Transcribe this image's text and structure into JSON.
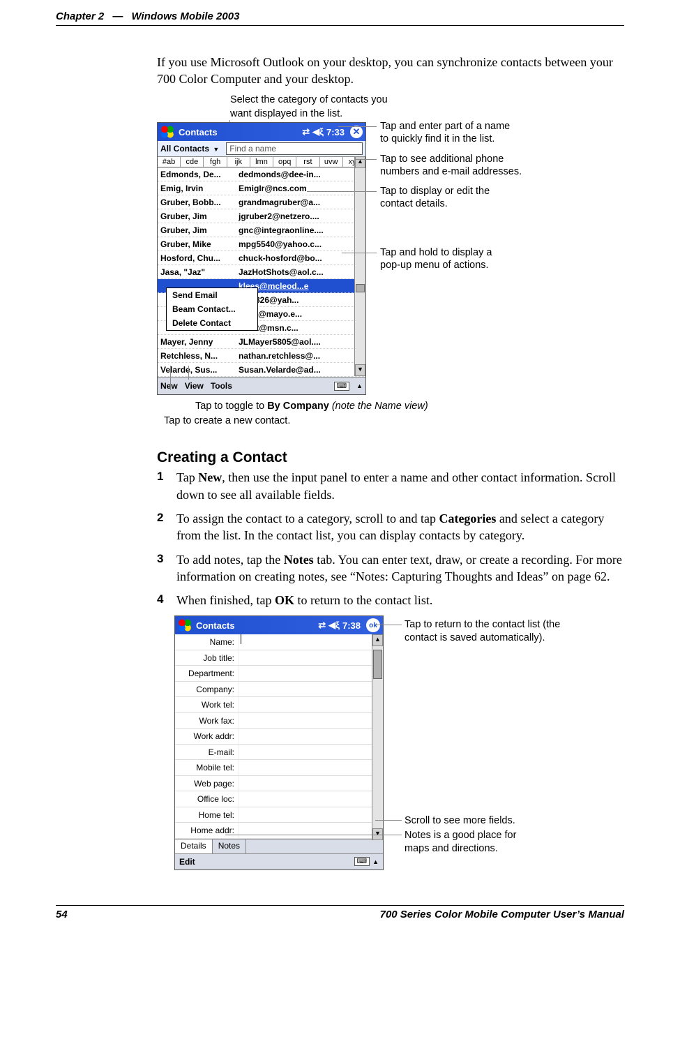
{
  "header": {
    "chapter": "Chapter 2",
    "dash": "—",
    "title": "Windows Mobile 2003"
  },
  "intro": "If you use Microsoft Outlook on your desktop, you can synchronize contacts between your 700 Color Computer and your desktop.",
  "callouts_top1": "Select the category of contacts you",
  "callouts_top2": "want displayed in the list.",
  "screenshot1": {
    "title": "Contacts",
    "time": "7:33",
    "category": "All Contacts",
    "find_placeholder": "Find a name",
    "alpha": [
      "#ab",
      "cde",
      "fgh",
      "ijk",
      "lmn",
      "opq",
      "rst",
      "uvw",
      "xyz"
    ],
    "rows": [
      {
        "n": "Edmonds, De...",
        "v": "dedmonds@dee-in...",
        "t": "e"
      },
      {
        "n": "Emig, Irvin",
        "v": "EmigIr@ncs.com",
        "t": "e"
      },
      {
        "n": "Gruber, Bobb...",
        "v": "grandmagruber@a...",
        "t": "e"
      },
      {
        "n": "Gruber, Jim",
        "v": "jgruber2@netzero....",
        "t": "e"
      },
      {
        "n": "Gruber, Jim",
        "v": "gnc@integraonline....",
        "t": "e"
      },
      {
        "n": "Gruber, Mike",
        "v": "mpg5540@yahoo.c...",
        "t": "e"
      },
      {
        "n": "Hosford, Chu...",
        "v": "chuck-hosford@bo...",
        "t": "e"
      },
      {
        "n": "Jasa, \"Jaz\"",
        "v": "JazHotShots@aol.c...",
        "t": "e"
      },
      {
        "n": "",
        "v": "klees@mcleod...e",
        "t": ""
      },
      {
        "n": "",
        "v": "ide0826@yah...",
        "t": "e"
      },
      {
        "n": "",
        "v": "linda@mayo.e...",
        "t": "e"
      },
      {
        "n": "",
        "v": "bert2@msn.c...",
        "t": "e"
      },
      {
        "n": "Mayer, Jenny",
        "v": "JLMayer5805@aol....",
        "t": "e"
      },
      {
        "n": "Retchless, N...",
        "v": "nathan.retchless@...",
        "t": "e"
      },
      {
        "n": "Velarde, Sus...",
        "v": "Susan.Velarde@ad...",
        "t": "e"
      }
    ],
    "ctx": {
      "send": "Send Email",
      "beam": "Beam Contact...",
      "del": "Delete Contact"
    },
    "menu": {
      "new": "New",
      "view": "View",
      "tools": "Tools"
    }
  },
  "side_callouts1": {
    "a1": "Tap and enter part of a name",
    "a2": "to quickly find it in the list.",
    "b1": "Tap to see additional phone",
    "b2": "numbers and e-mail addresses.",
    "c1": "Tap to display or edit the",
    "c2": "contact details.",
    "d1": "Tap and hold to display a",
    "d2": "pop-up menu of actions."
  },
  "bottom_callouts1": {
    "a_pre": "Tap to toggle to ",
    "a_bold": "By Company",
    "a_ital": " (note the Name view)",
    "b": "Tap to create a new contact."
  },
  "section_title": "Creating a Contact",
  "steps": {
    "s1_pre": "Tap ",
    "s1_bold": "New",
    "s1_post": ", then use the input panel to enter a name and other contact information. Scroll down to see all available fields.",
    "s2_pre": "To assign the contact to a category, scroll to and tap ",
    "s2_bold": "Categories",
    "s2_post": " and select a category from the list. In the contact list, you can display contacts by category.",
    "s3_pre": "To add notes, tap the ",
    "s3_bold": "Notes",
    "s3_post": " tab. You can enter text, draw, or create a recording. For more information on creating notes, see “Notes: Capturing Thoughts and Ideas” on page 62.",
    "s4_pre": "When finished, tap ",
    "s4_bold": "OK",
    "s4_post": " to return to the contact list."
  },
  "screenshot2": {
    "title": "Contacts",
    "time": "7:38",
    "ok": "ok",
    "fields": [
      "Name:",
      "Job title:",
      "Department:",
      "Company:",
      "Work tel:",
      "Work fax:",
      "Work addr:",
      "E-mail:",
      "Mobile tel:",
      "Web page:",
      "Office loc:",
      "Home tel:",
      "Home addr:"
    ],
    "tabs": {
      "details": "Details",
      "notes": "Notes"
    },
    "edit": "Edit"
  },
  "side_callouts2": {
    "a1": "Tap to return to the contact list (the",
    "a2": "contact is saved automatically).",
    "b1": "Scroll to see more fields.",
    "c1": "Notes is a good place for",
    "c2": "maps and directions."
  },
  "footer": {
    "page": "54",
    "right": "700 Series Color Mobile Computer User’s Manual"
  }
}
